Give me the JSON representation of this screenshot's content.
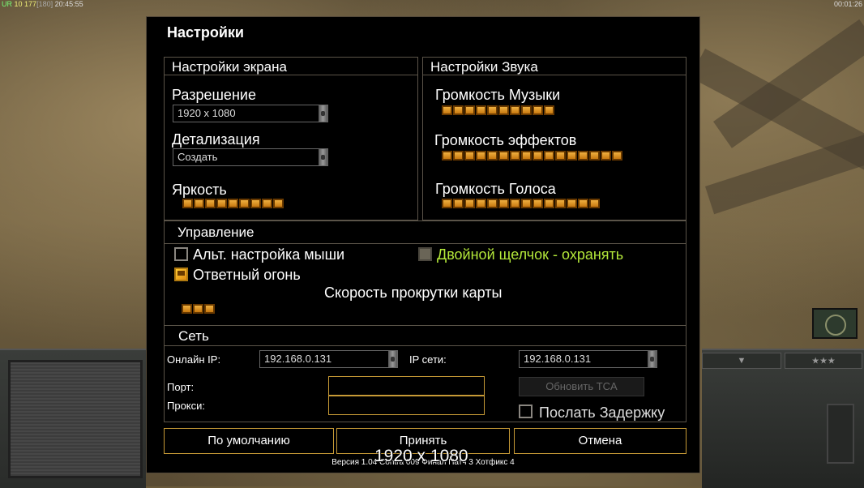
{
  "hud": {
    "left_green": "UR",
    "left_num1": "10",
    "left_num2": "177",
    "left_bracket": "[180]",
    "left_time": "20:45:55",
    "right_time": "00:01:26"
  },
  "dialog": {
    "title": "Настройки",
    "screen": {
      "title": "Настройки экрана",
      "resolution_label": "Разрешение",
      "resolution_value": "1920 x 1080",
      "detail_label": "Детализация",
      "detail_value": "Создать",
      "brightness_label": "Яркость",
      "brightness_level": 9,
      "brightness_max": 9
    },
    "sound": {
      "title": "Настройки Звука",
      "music_label": "Громкость Музыки",
      "music_level": 10,
      "effects_label": "Громкость эффектов",
      "effects_level": 16,
      "voice_label": "Громкость Голоса",
      "voice_level": 14
    },
    "controls": {
      "title": "Управление",
      "alt_mouse_label": "Альт. настройка мыши",
      "alt_mouse_checked": false,
      "double_click_label": "Двойной щелчок - охранять",
      "double_click_checked": false,
      "return_fire_label": "Ответный огонь",
      "return_fire_checked": true,
      "scroll_label": "Скорость прокрутки карты",
      "scroll_level": 3
    },
    "network": {
      "title": "Сеть",
      "online_ip_label": "Онлайн IP:",
      "online_ip_value": "192.168.0.131",
      "lan_ip_label": "IP сети:",
      "lan_ip_value": "192.168.0.131",
      "port_label": "Порт:",
      "port_value": "",
      "proxy_label": "Прокси:",
      "proxy_value": "",
      "update_tca_label": "Обновить TCA",
      "send_delay_label": "Послать Задержку",
      "send_delay_checked": false
    },
    "buttons": {
      "default_label": "По умолчанию",
      "accept_label": "Принять",
      "cancel_label": "Отмена"
    },
    "version": "Версия 1.04 Contra 009 Финал Патч 3 Хотфикс 4",
    "overlay_resolution": "1920 x 1080"
  },
  "colors": {
    "slider_on": "#f0b040",
    "highlight_text": "#b4e83a",
    "border_gold": "#c79a36"
  }
}
